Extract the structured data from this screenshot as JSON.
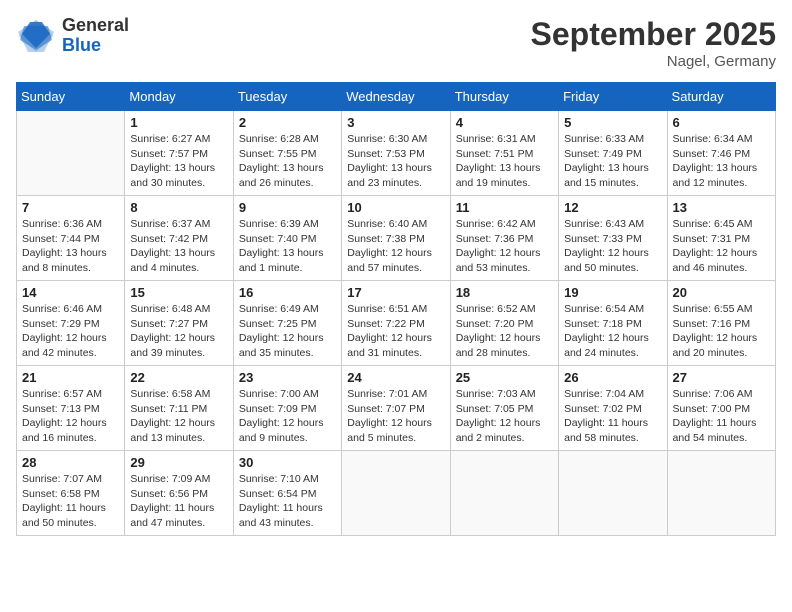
{
  "header": {
    "logo_general": "General",
    "logo_blue": "Blue",
    "title": "September 2025",
    "location": "Nagel, Germany"
  },
  "weekdays": [
    "Sunday",
    "Monday",
    "Tuesday",
    "Wednesday",
    "Thursday",
    "Friday",
    "Saturday"
  ],
  "weeks": [
    [
      {
        "day": "",
        "info": ""
      },
      {
        "day": "1",
        "info": "Sunrise: 6:27 AM\nSunset: 7:57 PM\nDaylight: 13 hours\nand 30 minutes."
      },
      {
        "day": "2",
        "info": "Sunrise: 6:28 AM\nSunset: 7:55 PM\nDaylight: 13 hours\nand 26 minutes."
      },
      {
        "day": "3",
        "info": "Sunrise: 6:30 AM\nSunset: 7:53 PM\nDaylight: 13 hours\nand 23 minutes."
      },
      {
        "day": "4",
        "info": "Sunrise: 6:31 AM\nSunset: 7:51 PM\nDaylight: 13 hours\nand 19 minutes."
      },
      {
        "day": "5",
        "info": "Sunrise: 6:33 AM\nSunset: 7:49 PM\nDaylight: 13 hours\nand 15 minutes."
      },
      {
        "day": "6",
        "info": "Sunrise: 6:34 AM\nSunset: 7:46 PM\nDaylight: 13 hours\nand 12 minutes."
      }
    ],
    [
      {
        "day": "7",
        "info": "Sunrise: 6:36 AM\nSunset: 7:44 PM\nDaylight: 13 hours\nand 8 minutes."
      },
      {
        "day": "8",
        "info": "Sunrise: 6:37 AM\nSunset: 7:42 PM\nDaylight: 13 hours\nand 4 minutes."
      },
      {
        "day": "9",
        "info": "Sunrise: 6:39 AM\nSunset: 7:40 PM\nDaylight: 13 hours\nand 1 minute."
      },
      {
        "day": "10",
        "info": "Sunrise: 6:40 AM\nSunset: 7:38 PM\nDaylight: 12 hours\nand 57 minutes."
      },
      {
        "day": "11",
        "info": "Sunrise: 6:42 AM\nSunset: 7:36 PM\nDaylight: 12 hours\nand 53 minutes."
      },
      {
        "day": "12",
        "info": "Sunrise: 6:43 AM\nSunset: 7:33 PM\nDaylight: 12 hours\nand 50 minutes."
      },
      {
        "day": "13",
        "info": "Sunrise: 6:45 AM\nSunset: 7:31 PM\nDaylight: 12 hours\nand 46 minutes."
      }
    ],
    [
      {
        "day": "14",
        "info": "Sunrise: 6:46 AM\nSunset: 7:29 PM\nDaylight: 12 hours\nand 42 minutes."
      },
      {
        "day": "15",
        "info": "Sunrise: 6:48 AM\nSunset: 7:27 PM\nDaylight: 12 hours\nand 39 minutes."
      },
      {
        "day": "16",
        "info": "Sunrise: 6:49 AM\nSunset: 7:25 PM\nDaylight: 12 hours\nand 35 minutes."
      },
      {
        "day": "17",
        "info": "Sunrise: 6:51 AM\nSunset: 7:22 PM\nDaylight: 12 hours\nand 31 minutes."
      },
      {
        "day": "18",
        "info": "Sunrise: 6:52 AM\nSunset: 7:20 PM\nDaylight: 12 hours\nand 28 minutes."
      },
      {
        "day": "19",
        "info": "Sunrise: 6:54 AM\nSunset: 7:18 PM\nDaylight: 12 hours\nand 24 minutes."
      },
      {
        "day": "20",
        "info": "Sunrise: 6:55 AM\nSunset: 7:16 PM\nDaylight: 12 hours\nand 20 minutes."
      }
    ],
    [
      {
        "day": "21",
        "info": "Sunrise: 6:57 AM\nSunset: 7:13 PM\nDaylight: 12 hours\nand 16 minutes."
      },
      {
        "day": "22",
        "info": "Sunrise: 6:58 AM\nSunset: 7:11 PM\nDaylight: 12 hours\nand 13 minutes."
      },
      {
        "day": "23",
        "info": "Sunrise: 7:00 AM\nSunset: 7:09 PM\nDaylight: 12 hours\nand 9 minutes."
      },
      {
        "day": "24",
        "info": "Sunrise: 7:01 AM\nSunset: 7:07 PM\nDaylight: 12 hours\nand 5 minutes."
      },
      {
        "day": "25",
        "info": "Sunrise: 7:03 AM\nSunset: 7:05 PM\nDaylight: 12 hours\nand 2 minutes."
      },
      {
        "day": "26",
        "info": "Sunrise: 7:04 AM\nSunset: 7:02 PM\nDaylight: 11 hours\nand 58 minutes."
      },
      {
        "day": "27",
        "info": "Sunrise: 7:06 AM\nSunset: 7:00 PM\nDaylight: 11 hours\nand 54 minutes."
      }
    ],
    [
      {
        "day": "28",
        "info": "Sunrise: 7:07 AM\nSunset: 6:58 PM\nDaylight: 11 hours\nand 50 minutes."
      },
      {
        "day": "29",
        "info": "Sunrise: 7:09 AM\nSunset: 6:56 PM\nDaylight: 11 hours\nand 47 minutes."
      },
      {
        "day": "30",
        "info": "Sunrise: 7:10 AM\nSunset: 6:54 PM\nDaylight: 11 hours\nand 43 minutes."
      },
      {
        "day": "",
        "info": ""
      },
      {
        "day": "",
        "info": ""
      },
      {
        "day": "",
        "info": ""
      },
      {
        "day": "",
        "info": ""
      }
    ]
  ]
}
